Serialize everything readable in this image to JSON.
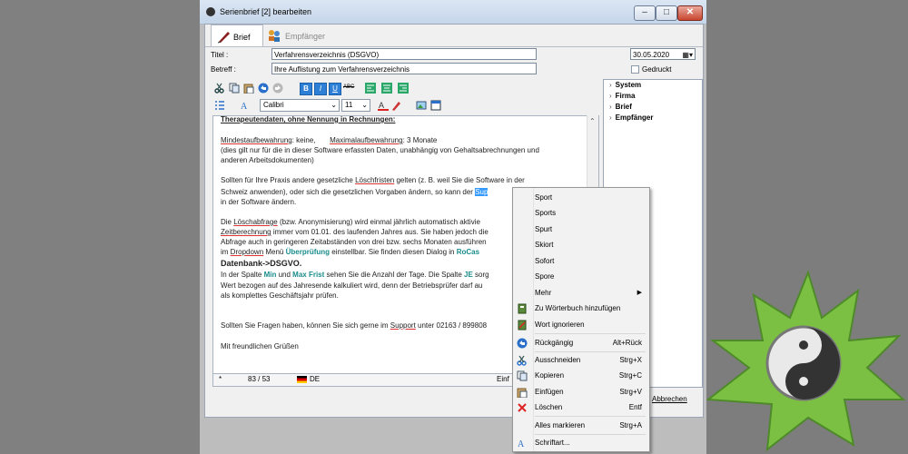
{
  "window": {
    "title": "Serienbrief [2] bearbeiten"
  },
  "tabs": [
    {
      "label": "Brief"
    },
    {
      "label": "Empfänger"
    }
  ],
  "form": {
    "titel_label": "Titel :",
    "titel_value": "Verfahrensverzeichnis (DSGVO)",
    "betreff_label": "Betreff :",
    "betreff_value": "Ihre Auflistung zum Verfahrensverzeichnis",
    "date_value": "30.05.2020",
    "gedruckt_label": "Gedruckt"
  },
  "toolbar": {
    "font_value": "Calibri",
    "size_value": "11",
    "strike_label": "ABC"
  },
  "editor": {
    "line1": "Therapeutendaten, ohne Nennung in Rechnungen:",
    "line2a": "Mindestaufbewahrung",
    "line2b": ": keine,",
    "line2c": "Maximalaufbewahrung",
    "line2d": ": 3 Monate",
    "line3": "(dies gilt nur für die in dieser Software erfassten Daten, unabhängig von Gehaltsabrechnungen und",
    "line4": "anderen Arbeitsdokumenten)",
    "line5a": "Sollten für Ihre Praxis andere gesetzliche ",
    "line5b": "Löschfristen",
    "line5c": " gelten (z. B. weil Sie die Software in der",
    "line6a": "Schweiz anwenden), oder sich die gesetzlichen Vorgaben ändern, so kann der ",
    "line6b": "Sup",
    "line7": "in der Software ändern.",
    "line8a": "Die ",
    "line8b": "Löschabfrage",
    "line8c": " (bzw. Anonymisierung) wird einmal jährlich automatisch aktivie",
    "line9a": "Zeitberechnung",
    "line9b": " immer vom 01.01. des laufenden Jahres aus. Sie haben jedoch die",
    "line10": "Abfrage auch in geringeren Zeitabständen von drei bzw. sechs Monaten ausführen",
    "line11a": "im ",
    "line11b": "Dropdown",
    "line11c": " Menü ",
    "line11d": "Überprüfung",
    "line11e": " einstellbar. Sie finden diesen Dialog in ",
    "line11f": "RoCas",
    "line12": "Datenbank->DSGVO.",
    "line13a": "In der Spalte ",
    "line13b": "Min",
    "line13c": " und ",
    "line13d": "Max Frist",
    "line13e": " sehen Sie die Anzahl der Tage. Die Spalte ",
    "line13f": "JE",
    "line13g": " sorg",
    "line14": "Wert bezogen auf des Jahresende kalkuliert wird, denn der Betriebsprüfer darf au",
    "line15": "als komplettes Geschäftsjahr prüfen.",
    "line16a": "Sollten Sie Fragen haben, können Sie sich gerne im ",
    "line16b": "Support",
    "line16c": " unter 02163 / 899808",
    "line17": "Mit freundlichen Grüßen"
  },
  "statusbar": {
    "star": "*",
    "position": "83 / 53",
    "lang": "DE",
    "mode": "Einf"
  },
  "tree": [
    {
      "label": "System"
    },
    {
      "label": "Firma"
    },
    {
      "label": "Brief"
    },
    {
      "label": "Empfänger"
    }
  ],
  "cancel_label": "Abbrechen",
  "context_menu": {
    "suggestions": [
      "Sport",
      "Sports",
      "Spurt",
      "Skiort",
      "Sofort",
      "Spore"
    ],
    "more": "Mehr",
    "add_dict": "Zu Wörterbuch hinzufügen",
    "ignore": "Wort ignorieren",
    "undo": "Rückgängig",
    "undo_key": "Alt+Rück",
    "cut": "Ausschneiden",
    "cut_key": "Strg+X",
    "copy": "Kopieren",
    "copy_key": "Strg+C",
    "paste": "Einfügen",
    "paste_key": "Strg+V",
    "delete": "Löschen",
    "delete_key": "Entf",
    "select_all": "Alles markieren",
    "select_all_key": "Strg+A",
    "font": "Schriftart..."
  }
}
